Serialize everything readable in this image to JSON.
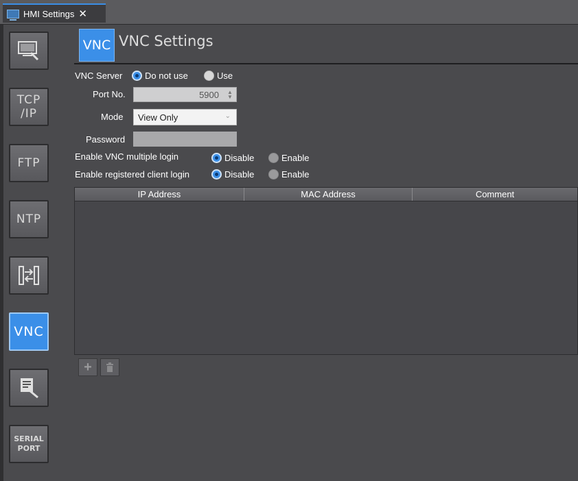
{
  "tab": {
    "title": "HMI Settings",
    "close_label": "✕"
  },
  "nav": [
    {
      "name": "monitor-settings",
      "label": ""
    },
    {
      "name": "tcpip",
      "label": "TCP\n/IP"
    },
    {
      "name": "ftp",
      "label": "FTP"
    },
    {
      "name": "ntp",
      "label": "NTP"
    },
    {
      "name": "data-transfer",
      "label": ""
    },
    {
      "name": "vnc",
      "label": "VNC",
      "active": true
    },
    {
      "name": "diagnostics",
      "label": ""
    },
    {
      "name": "serial-port",
      "label": "SERIAL\nPORT"
    }
  ],
  "header": {
    "badge": "VNC",
    "title": "VNC Settings"
  },
  "form": {
    "vnc_server_label": "VNC Server",
    "vnc_server_options": [
      "Do not use",
      "Use"
    ],
    "vnc_server_selected": "Do not use",
    "port_label": "Port No.",
    "port_value": "5900",
    "mode_label": "Mode",
    "mode_value": "View Only",
    "password_label": "Password",
    "password_value": "",
    "multi_login_label": "Enable VNC multiple login",
    "multi_login_options": [
      "Disable",
      "Enable"
    ],
    "multi_login_selected": "Disable",
    "reg_client_label": "Enable registered client login",
    "reg_client_options": [
      "Disable",
      "Enable"
    ],
    "reg_client_selected": "Disable"
  },
  "table": {
    "columns": [
      "IP Address",
      "MAC Address",
      "Comment"
    ],
    "rows": []
  },
  "toolbar": {
    "add_icon": "plus-icon",
    "delete_icon": "trash-icon"
  },
  "colors": {
    "accent": "#3b8fe8",
    "panel": "#4a4a4d",
    "tab_border": "#3a8ee6"
  }
}
